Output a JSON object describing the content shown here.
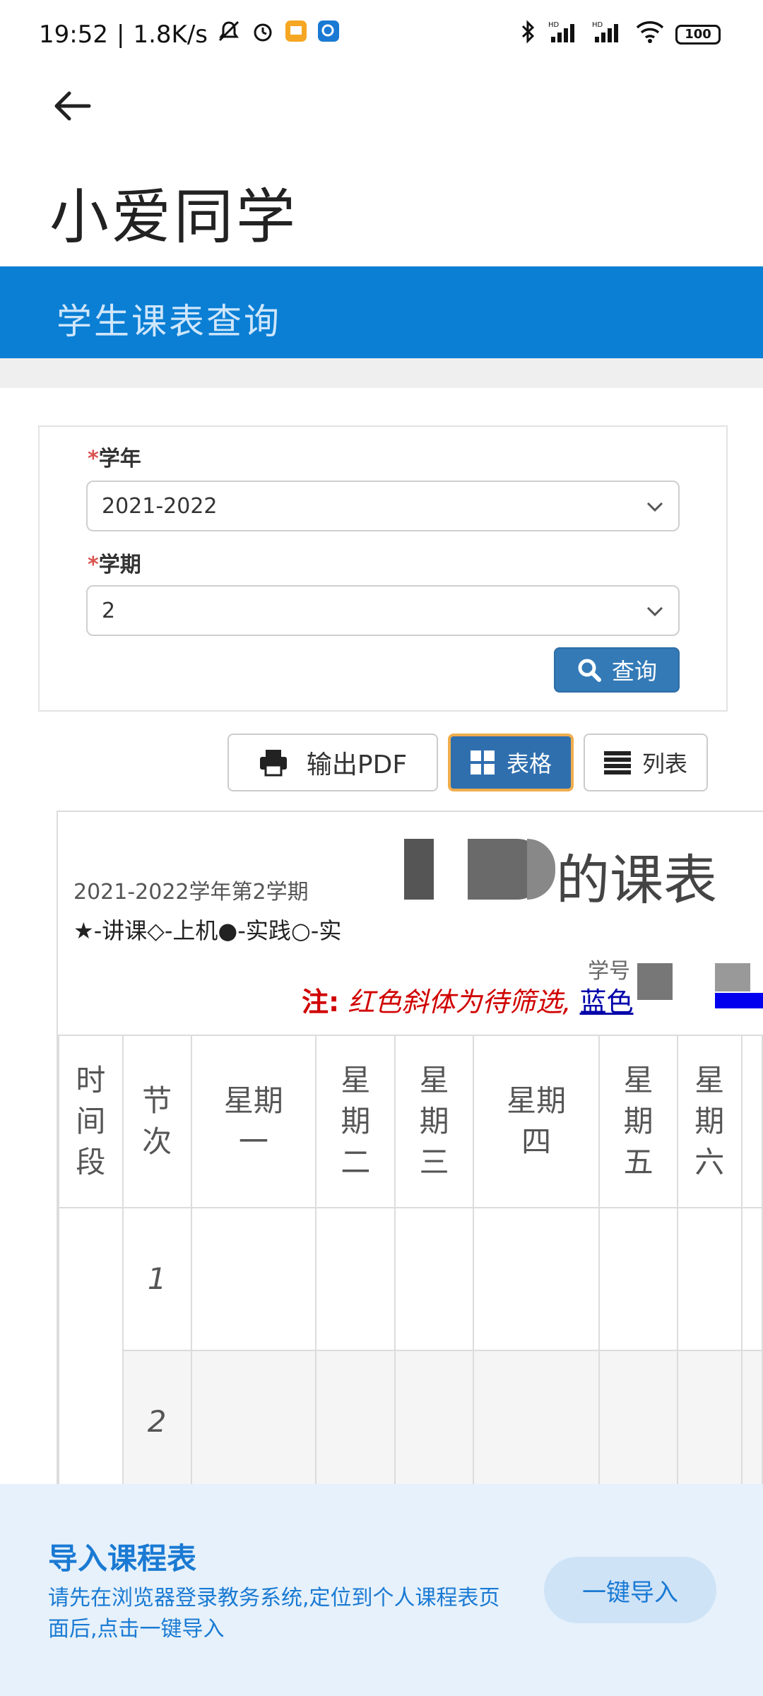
{
  "status": {
    "time": "19:52",
    "speed": "1.8K/s",
    "net1": "HD",
    "net2": "HD",
    "battery": "100"
  },
  "app": {
    "title": "小爱同学",
    "page_title": "学生课表查询"
  },
  "form": {
    "year_label": "学年",
    "year_value": "2021-2022",
    "term_label": "学期",
    "term_value": "2",
    "required_mark": "*",
    "search_label": "查询"
  },
  "toolbar": {
    "pdf_label": "输出PDF",
    "table_label": "表格",
    "list_label": "列表"
  },
  "schedule": {
    "title_suffix": "的课表",
    "term": "2021-2022学年第2学期",
    "legend": "★-讲课◇-上机●-实践○-实",
    "student_id_label": "学号",
    "note_label": "注:",
    "note_text": "红色斜体为待筛选,",
    "note_blue": "蓝色",
    "headers": [
      "时\n间\n段",
      "节\n次",
      "星期\n一",
      "星\n期\n二",
      "星\n期\n三",
      "星期\n四",
      "星\n期\n五",
      "星\n期\n六"
    ],
    "rows": [
      "1",
      "2"
    ]
  },
  "import_panel": {
    "title": "导入课程表",
    "description": "请先在浏览器登录教务系统,定位到个人课程表页面后,点击一键导入",
    "button": "一键导入"
  },
  "colors": {
    "accent_blue": "#0a7fd4",
    "button_blue": "#337ab7",
    "active_border": "#f0ad4e",
    "note_red": "#d00000",
    "import_bg": "#e6f1fb"
  }
}
